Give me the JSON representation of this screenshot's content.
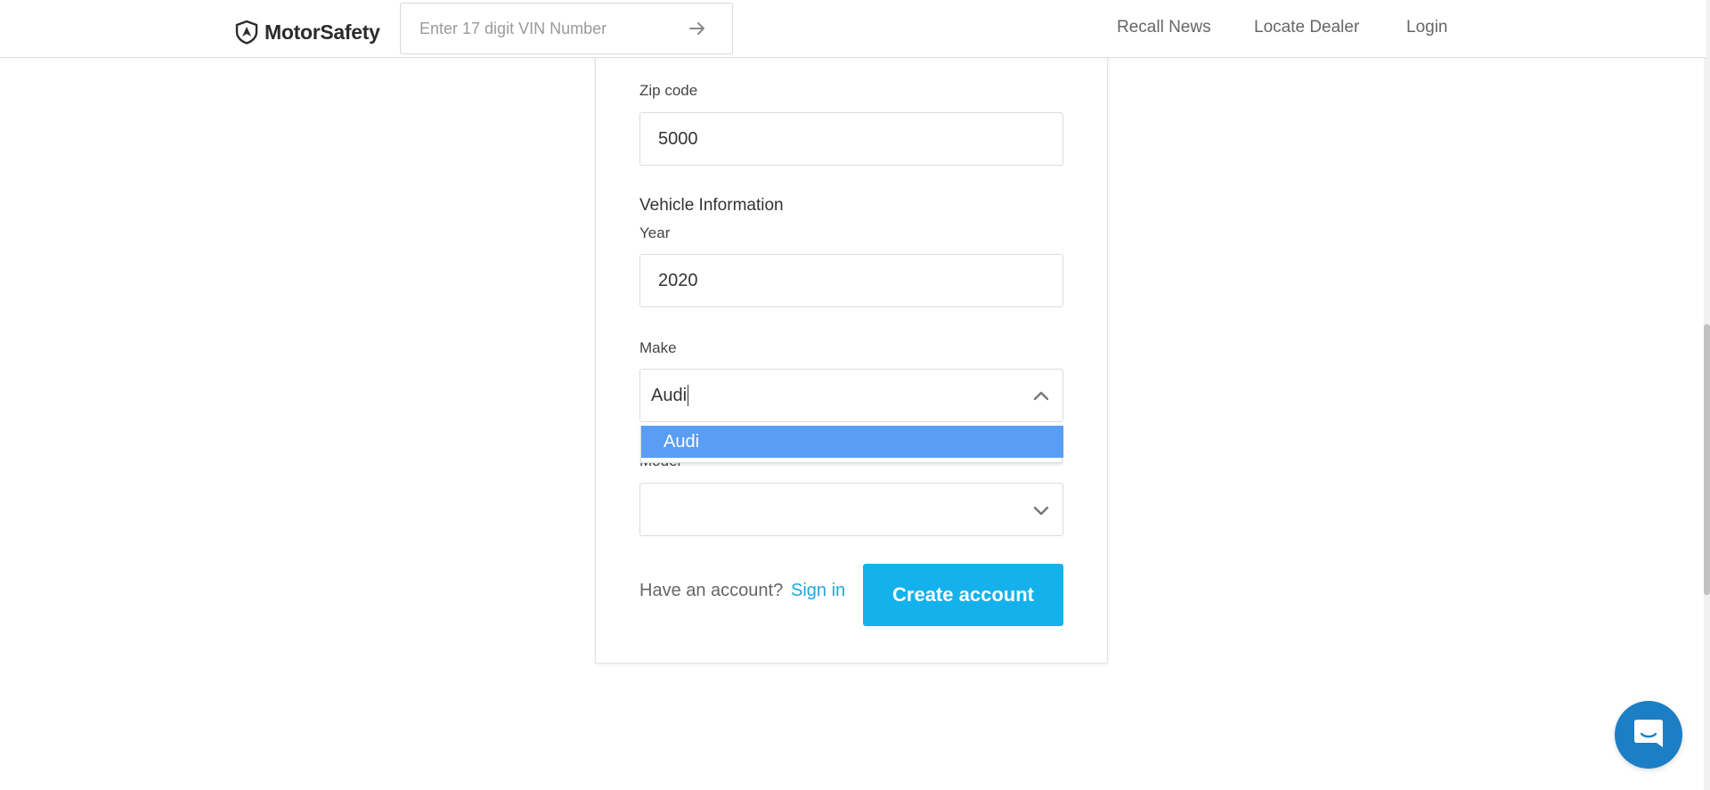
{
  "header": {
    "logo_text": "MotorSafety",
    "vin_placeholder": "Enter 17 digit VIN Number",
    "nav": {
      "recall_news": "Recall News",
      "locate_dealer": "Locate Dealer",
      "login": "Login"
    }
  },
  "form": {
    "zip_label": "Zip code",
    "zip_value": "5000",
    "vehicle_section": "Vehicle Information",
    "year_label": "Year",
    "year_value": "2020",
    "make_label": "Make",
    "make_value": "Audi",
    "make_options": [
      "Audi"
    ],
    "model_label": "Model",
    "model_value": "",
    "have_account": "Have an account?",
    "sign_in": "Sign in",
    "create_account": "Create account"
  },
  "colors": {
    "accent": "#14b1ec",
    "link": "#1ea8e0",
    "dropdown_highlight": "#5a9df5",
    "chat": "#1c7ec5"
  },
  "icons": {
    "logo": "shield-logo-icon",
    "vin_submit": "arrow-right-icon",
    "make_toggle": "chevron-up-icon",
    "model_toggle": "chevron-down-icon",
    "chat": "chat-icon"
  }
}
